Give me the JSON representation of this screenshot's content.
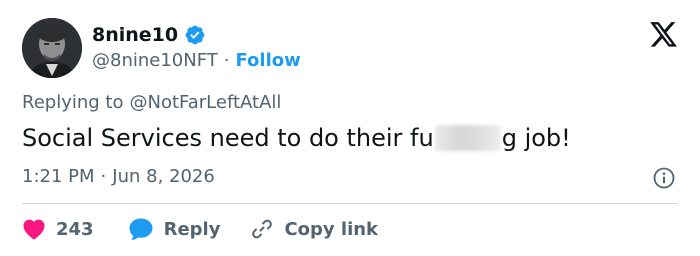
{
  "user": {
    "display_name": "8nine10",
    "handle": "@8nine10NFT",
    "separator": "·",
    "follow_label": "Follow",
    "verified": true
  },
  "reply": {
    "prefix": "Replying to",
    "to_handle": "@NotFarLeftAtAll"
  },
  "tweet": {
    "text_before": "Social Services need to do their fu",
    "text_after": "g job!",
    "censored": true,
    "time": "1:21 PM",
    "separator": "·",
    "date": "Jun 8, 2026"
  },
  "actions": {
    "like_count": "243",
    "reply_label": "Reply",
    "copy_label": "Copy link"
  },
  "icons": {
    "verified": "verified-badge-icon",
    "x_logo": "x-logo-icon",
    "info": "info-icon",
    "heart": "heart-icon",
    "reply": "reply-bubble-icon",
    "link": "link-icon"
  },
  "colors": {
    "accent": "#1d9bf0",
    "like": "#f91880",
    "text": "#0f1419",
    "muted": "#536471",
    "divider": "#cfd9de"
  }
}
